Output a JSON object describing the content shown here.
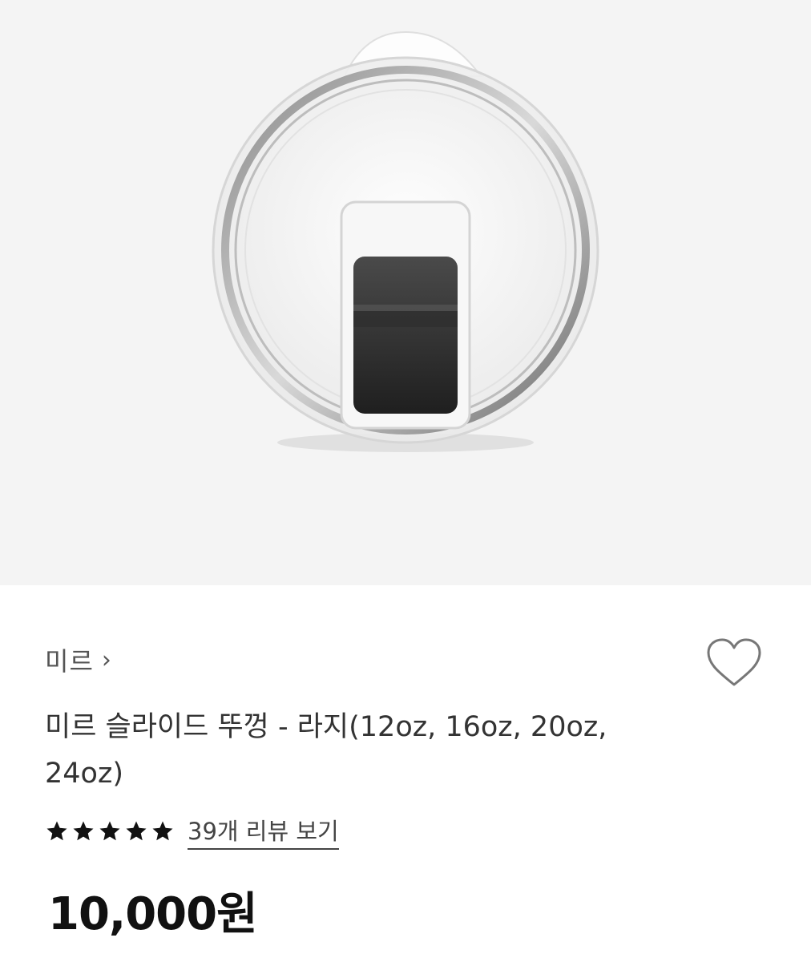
{
  "product": {
    "image_alt": "clear slide lid product image",
    "brand": "미르",
    "brand_chevron": "›",
    "title": "미르 슬라이드 뚜껑 - 라지(12oz, 16oz, 20oz, 24oz)",
    "rating_stars": 5,
    "review_link": "39개 리뷰 보기",
    "price": "10,000원"
  },
  "icons": {
    "wishlist": "heart-outline-icon",
    "star": "star-icon",
    "brand_arrow": "chevron-right-icon"
  },
  "colors": {
    "hero_bg": "#f4f4f4",
    "text_primary": "#111111",
    "text_secondary": "#555555"
  }
}
